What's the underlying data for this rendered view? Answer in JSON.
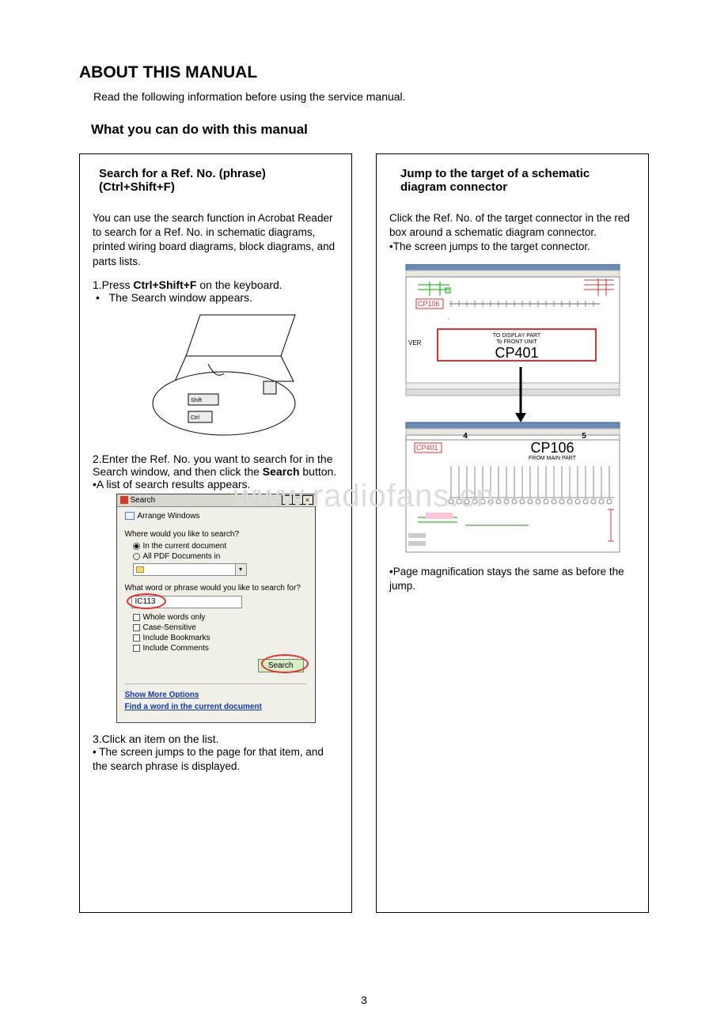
{
  "page": {
    "title": "ABOUT THIS MANUAL",
    "intro": "Read the following information before using the service manual.",
    "subtitle": "What you can do with this manual",
    "number": "3",
    "watermark": "www.radiofans.cn"
  },
  "left": {
    "title": "Search for a Ref. No. (phrase) (Ctrl+Shift+F)",
    "desc": "You can use the search function in Acrobat Reader to search for a Ref. No. in schematic diagrams, printed wiring board diagrams, block diagrams, and parts lists.",
    "step1_pre": "1.Press ",
    "step1_bold": "Ctrl+Shift+F",
    "step1_post": " on the keyboard.",
    "step1_bullet": "The Search window appears.",
    "laptop": {
      "shift": "Shift",
      "ctrl": "Ctrl"
    },
    "step2_pre": "2.Enter the Ref. No. you want to search for in the Search window, and then click the ",
    "step2_bold": "Search",
    "step2_post": " button.",
    "step2_bullet": "•A list of search results appears.",
    "dialog": {
      "title": "Search",
      "arrange": "Arrange Windows",
      "where_label": "Where would you like to search?",
      "radio_current": "In the current document",
      "radio_all": "All PDF Documents in",
      "what_label": "What word or phrase would you like to search for?",
      "input_value": "IC113",
      "opt_whole": "Whole words only",
      "opt_case": "Case-Sensitive",
      "opt_bookmarks": "Include Bookmarks",
      "opt_comments": "Include Comments",
      "search_btn": "Search",
      "link_more": "Show More Options",
      "link_find": "Find a word in the current document"
    },
    "step3_line1": "3.Click an item on the list.",
    "step3_line2": "• The screen jumps to the page for that item, and the search phrase is displayed."
  },
  "right": {
    "title": "Jump to the target of a schematic diagram connector",
    "desc1": "Click the Ref. No. of the target connector in the red box around a schematic diagram connector.",
    "desc2": "•The screen jumps to the target connector.",
    "schem_top": {
      "left_label": "VER",
      "cp_badge": "CP106",
      "to1": "TO DISPLAY PART",
      "to2": "To FRONT UNIT",
      "big": "CP401"
    },
    "schem_bottom": {
      "num4": "4",
      "num5": "5",
      "cp_badge": "CP401",
      "big": "CP106",
      "sub": "FROM MAIN PART"
    },
    "note": "•Page magnification stays the same as before the jump."
  }
}
